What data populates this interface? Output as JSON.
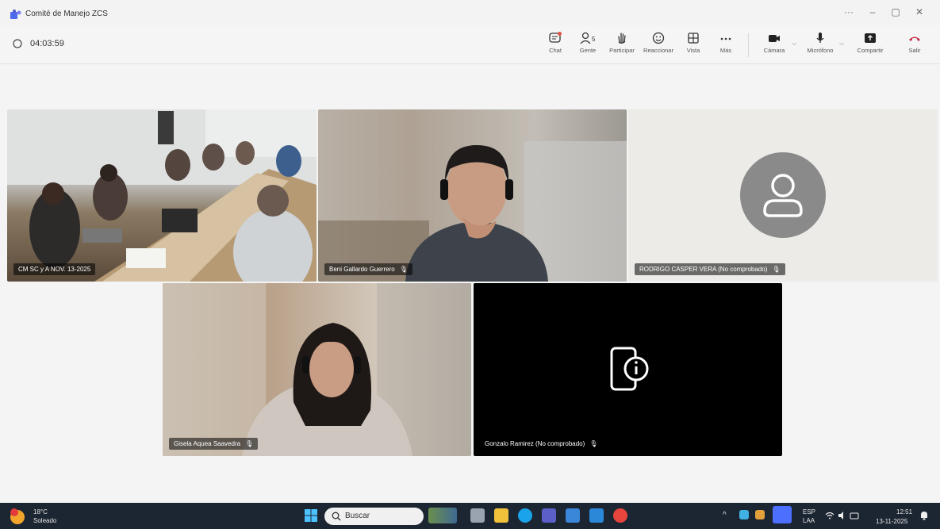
{
  "window": {
    "title": "Comité de Manejo ZCS",
    "controls": [
      "···",
      "–",
      "▢",
      "✕"
    ]
  },
  "meeting": {
    "timer": "04:03:59"
  },
  "toolbar": {
    "chat": "Chat",
    "people": "Gente",
    "people_count": "5",
    "raise": "Participar",
    "react": "Reaccionar",
    "view": "Vista",
    "more": "Más",
    "camera": "Cámara",
    "mic": "Micrófono",
    "share": "Compartir",
    "leave": "Salir"
  },
  "participants": [
    {
      "name": "CM SC y A NOV. 13-2025",
      "type": "room"
    },
    {
      "name": "Beni Gallardo Guerrero",
      "type": "video"
    },
    {
      "name": "RODRIGO CASPER VERA (No comprobado)",
      "type": "avatar"
    },
    {
      "name": "Gisela Aquea Saavedra",
      "type": "video"
    },
    {
      "name": "Gonzalo Ramirez (No comprobado)",
      "type": "device"
    }
  ],
  "taskbar": {
    "weather_temp": "18°C",
    "weather_desc": "Soleado",
    "search_placeholder": "Buscar",
    "lang": "ESP",
    "region": "LAA",
    "time": "12:51",
    "date": "13-11-2025"
  },
  "colors": {
    "leave": "#c4314b",
    "taskbar": "#1c2532",
    "accent": "#4f6bed"
  }
}
